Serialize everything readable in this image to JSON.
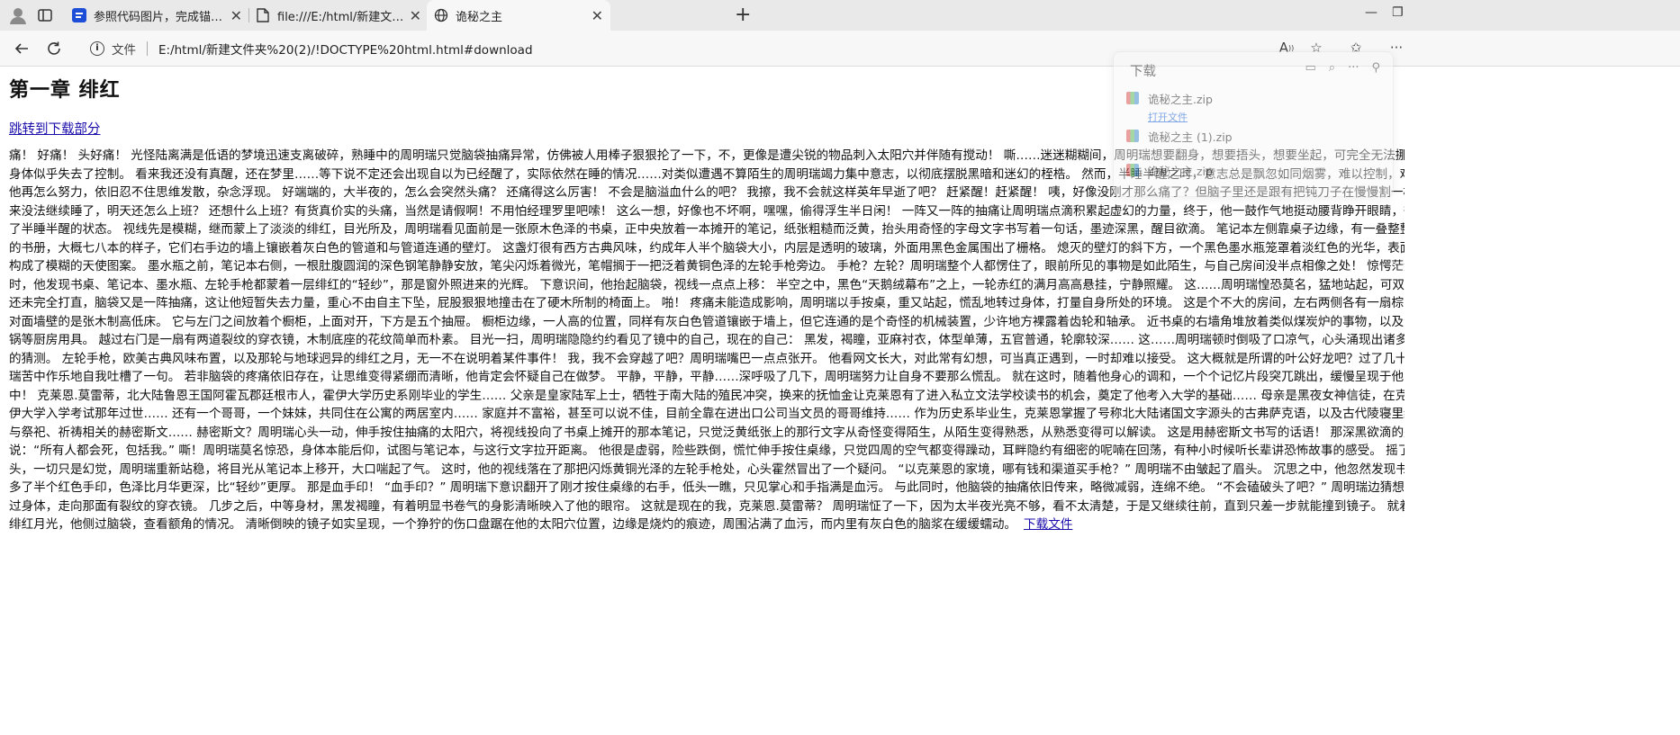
{
  "browser": {
    "tabs": [
      {
        "title": "参照代码图片，完成锚点和下载项",
        "active": false
      },
      {
        "title": "file:///E:/html/新建文件夹%20(2)/",
        "active": false
      },
      {
        "title": "诡秘之主",
        "active": true
      }
    ],
    "address": {
      "label": "文件",
      "url": "E:/html/新建文件夹%20(2)/!DOCTYPE%20html.html#download"
    }
  },
  "page": {
    "heading": "第一章 绯红",
    "jump_link": "跳转到下载部分",
    "lines": [
      "痛！ 好痛！ 头好痛！ 光怪陆离满是低语的梦境迅速支离破碎，熟睡中的周明瑞只觉脑袋抽痛异常，仿佛被人用棒子狠狠抡了一下，不，更像是遭尖锐的物品刺入太阳穴并伴随有搅动！ 嘶……迷迷糊糊间，周明瑞想要翻身，想要捂头，想要坐起，可完全无法挪动手脚，",
      "身体似乎失去了控制。 看来我还没有真醒，还在梦里……等下说不定还会出现自以为已经醒了，实际依然在睡的情况……对类似遭遇不算陌生的周明瑞竭力集中意志，以彻底摆脱黑暗和迷幻的桎梏。 然而，半睡半醒之时，意志总是飘忽如同烟雾，难以控制，难以集中，",
      "他再怎么努力，依旧忍不住思维发散，杂念浮现。 好端端的，大半夜的，怎么会突然头痛？ 还痛得这么厉害！ 不会是脑溢血什么的吧？ 我擦，我不会就这样英年早逝了吧？ 赶紧醒！赶紧醒！ 咦，好像没刚才那么痛了？但脑子里还是跟有把钝刀子在慢慢割一样。",
      "来没法继续睡了，明天还怎么上班？ 还想什么上班？有货真价实的头痛，当然是请假啊！不用怕经理罗里吧嗦！ 这么一想，好像也不坏啊，嘿嘿，偷得浮生半日闲！ 一阵又一阵的抽痛让周明瑞点滴积累起虚幻的力量，终于，他一鼓作气地挺动腰背睁开眼睛，彻底摆脱",
      "了半睡半醒的状态。 视线先是模糊，继而蒙上了淡淡的绯红，目光所及，周明瑞看见面前是一张原木色泽的书桌，正中央放着一本摊开的笔记，纸张粗糙而泛黄，抬头用奇怪的字母文字书写着一句话，墨迹深黑，醒目欲滴。 笔记本左侧靠桌子边缘，有一叠整整齐齐",
      "的书册，大概七八本的样子，它们右手边的墙上镶嵌着灰白色的管道和与管道连通的壁灯。 这盏灯很有西方古典风味，约成年人半个脑袋大小，内层是透明的玻璃，外面用黑色金属围出了栅格。 熄灭的壁灯的斜下方，一个黑色墨水瓶笼罩着淡红色的光华，表面的浮雕",
      "构成了模糊的天使图案。 墨水瓶之前，笔记本右侧，一根肚腹圆润的深色钢笔静静安放，笔尖闪烁着微光，笔帽搁于一把泛着黄铜色泽的左轮手枪旁边。 手枪？左轮？周明瑞整个人都愣住了，眼前所见的事物是如此陌生，与自己房间没半点相像之处！ 惊愕茫然的同",
      "时，他发现书桌、笔记本、墨水瓶、左轮手枪都蒙着一层绯红的“轻纱”，那是窗外照进来的光辉。 下意识间，他抬起脑袋，视线一点点上移： 半空之中，黑色“天鹅绒幕布”之上，一轮赤红的满月高高悬挂，宁静照耀。 这……周明瑞惶恐莫名，猛地站起，可双腿",
      "还未完全打直，脑袋又是一阵抽痛，这让他短暂失去力量，重心不由自主下坠，屁股狠狠地撞击在了硬木所制的椅面上。 啪！ 疼痛未能造成影响，周明瑞以手按桌，重又站起，慌乱地转过身体，打量自身所处的环境。 这是个不大的房间，左右两侧各有一扇棕门，",
      "对面墙壁的是张木制高低床。 它与左门之间放着个橱柜，上面对开，下方是五个抽屉。 橱柜边缘，一人高的位置，同样有灰白色管道镶嵌于墙上，但它连通的是个奇怪的机械装置，少许地方裸露着齿轮和轴承。 近书桌的右墙角堆放着类似煤炭炉的事物，以及汤锅、铁",
      "锅等厨房用具。 越过右门是一扇有两道裂纹的穿衣镜，木制底座的花纹简单而朴素。 目光一扫，周明瑞隐隐约约看见了镜中的自己，现在的自己： 黑发，褐瞳，亚麻衬衣，体型单薄，五官普通，轮廓较深…… 这……周明瑞顿时倒吸了口凉气，心头涌现出诸多无助无措",
      "的猜测。 左轮手枪，欧美古典风味布置，以及那轮与地球迥异的绯红之月，无一不在说明着某件事件！ 我，我不会穿越了吧？周明瑞嘴巴一点点张开。 他看网文长大，对此常有幻想，可当真正遇到，一时却难以接受。 这大概就是所谓的叶公好龙吧？过了几十秒，周明",
      "瑞苦中作乐地自我吐槽了一句。 若非脑袋的疼痛依旧存在，让思维变得紧绷而清晰，他肯定会怀疑自己在做梦。 平静，平静，平静……深呼吸了几下，周明瑞努力让自身不要那么慌乱。 就在这时，随着他身心的调和，一个个记忆片段突兀跳出，缓慢呈现于他的脑海之",
      "中！ 克莱恩.莫雷蒂，北大陆鲁恩王国阿霍瓦郡廷根市人，霍伊大学历史系刚毕业的学生…… 父亲是皇家陆军上士，牺牲于南大陆的殖民冲突，换来的抚恤金让克莱恩有了进入私立文法学校读书的机会，奠定了他考入大学的基础…… 母亲是黑夜女神信徒，在克莱恩通过霍",
      "伊大学入学考试那年过世…… 还有一个哥哥，一个妹妹，共同住在公寓的两居室内…… 家庭并不富裕，甚至可以说不佳，目前全靠在进出口公司当文员的哥哥维持…… 作为历史系毕业生，克莱恩掌握了号称北大陆诸国文字源头的古弗萨克语，以及古代陵寝里经常出现的，",
      "与祭祀、祈祷相关的赫密斯文…… 赫密斯文？周明瑞心头一动，伸手按住抽痛的太阳穴，将视线投向了书桌上摊开的那本笔记，只觉泛黄纸张上的那行文字从奇怪变得陌生，从陌生变得熟悉，从熟悉变得可以解读。 这是用赫密斯文书写的话语！ 那深黑欲滴的墨迹如此述",
      "说：“所有人都会死，包括我。” 嘶！周明瑞莫名惊恐，身体本能后仰，试图与笔记本，与这行文字拉开距离。 他很是虚弱，险些跌倒，慌忙伸手按住桌缘，只觉四周的空气都变得躁动，耳畔隐约有细密的呢喃在回荡，有种小时候听长辈讲恐怖故事的感受。 摇了摇",
      "头，一切只是幻觉，周明瑞重新站稳，将目光从笔记本上移开，大口喘起了气。 这时，他的视线落在了那把闪烁黄铜光泽的左轮手枪处，心头霍然冒出了一个疑问。 “以克莱恩的家境，哪有钱和渠道买手枪？” 周明瑞不由皱起了眉头。 沉思之中，他忽然发现书桌上",
      "多了半个红色手印，色泽比月华更深，比“轻纱”更厚。 那是血手印！ “血手印？” 周明瑞下意识翻开了刚才按住桌缘的右手，低头一瞧，只见掌心和手指满是血污。 与此同时，他脑袋的抽痛依旧传来，略微减弱，连绵不绝。 “不会磕破头了吧？” 周明瑞边猜想边转",
      "过身体，走向那面有裂纹的穿衣镜。 几步之后，中等身材，黑发褐瞳，有着明显书卷气的身影清晰映入了他的眼帘。 这就是现在的我，克莱恩.莫雷蒂？ 周明瑞怔了一下，因为太半夜光亮不够，看不太清楚，于是又继续往前，直到只差一步就能撞到镜子。 就着轻纱般的",
      "绯红月光，他侧过脑袋，查看额角的情况。 清晰倒映的镜子如实呈现，一个狰狞的伤口盘踞在他的太阳穴位置，边缘是烧灼的痕迹，周围沾满了血污，而内里有灰白色的脑浆在缓缓蠕动。"
    ],
    "download_link": "下载文件"
  },
  "downloads": {
    "title": "下载",
    "items": [
      {
        "name": "诡秘之主.zip",
        "action": "打开文件"
      },
      {
        "name": "诡秘之主 (1).zip",
        "action": ""
      },
      {
        "name": "诡秘之主.zip",
        "action": ""
      }
    ]
  }
}
